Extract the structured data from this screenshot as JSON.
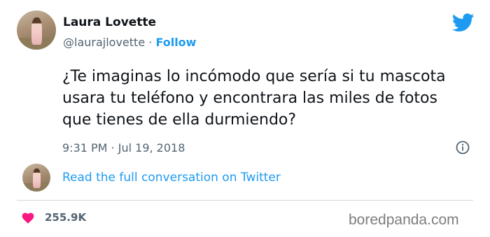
{
  "author": {
    "name": "Laura Lovette",
    "handle": "@laurajlovette",
    "separator": "·",
    "follow_label": "Follow"
  },
  "tweet": {
    "lines": [
      "¿Te imaginas lo incómodo que sería si tu mascota",
      "usara tu teléfono y encontrara las miles de fotos",
      "que tienes de ella durmiendo?"
    ],
    "time": "9:31 PM",
    "date": "Jul 19, 2018",
    "separator": "·"
  },
  "conversation_link": "Read the full conversation on Twitter",
  "likes": "255.9K",
  "watermark": "boredpanda.com",
  "colors": {
    "accent": "#1d9bf0",
    "heart": "#f91880",
    "muted": "#536471",
    "text": "#0f1419"
  },
  "icons": {
    "brand": "twitter-bird-icon",
    "info": "info-icon",
    "like": "heart-icon"
  }
}
